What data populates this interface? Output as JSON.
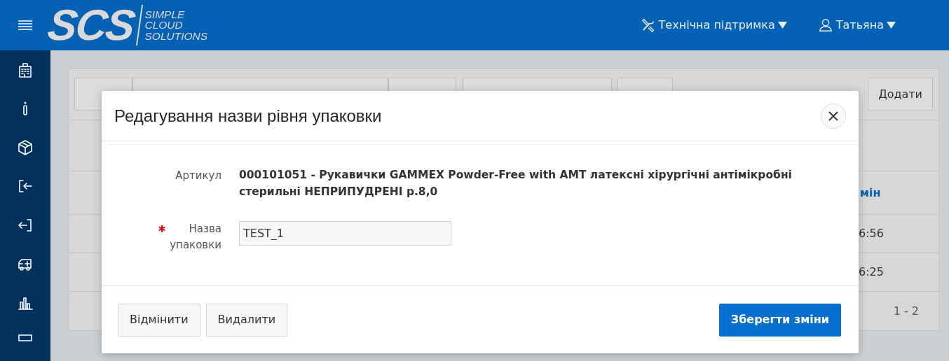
{
  "header": {
    "brand_mark": "SCS",
    "brand_lines": [
      "SIMPLE",
      "CLOUD",
      "SOLUTIONS"
    ],
    "menus": [
      {
        "label": "Технічна підтримка"
      },
      {
        "label": "Татьяна"
      }
    ]
  },
  "background": {
    "add_button": "Додати",
    "column_header": "мін",
    "cells": [
      "6:56",
      "6:25"
    ],
    "pagination": "1 - 2"
  },
  "modal": {
    "title": "Редагування назви рівня упаковки",
    "fields": [
      {
        "kind": "display",
        "label": "Артикул",
        "value": "000101051 - Рукавички GAMMEX Powder-Free with AMT латексні хірургічні антімікробні стерильні НЕПРИПУДРЕНІ р.8,0"
      },
      {
        "kind": "input",
        "label": "Назва упаковки",
        "required": true,
        "value": "TEST_1"
      }
    ],
    "buttons": [
      {
        "label": "Відмінити",
        "kind": "secondary"
      },
      {
        "label": "Видалити",
        "kind": "secondary"
      },
      {
        "label": "Зберегти зміни",
        "kind": "primary"
      }
    ]
  }
}
